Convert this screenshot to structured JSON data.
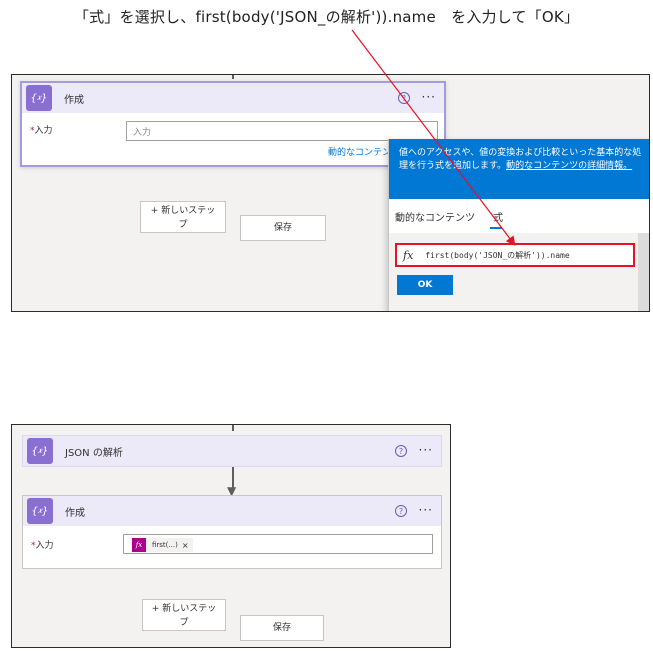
{
  "instruction": "「式」を選択し、first(body('JSON_の解析')).name　を入力して「OK」",
  "screen1": {
    "card_title": "作成",
    "input_label": "入力",
    "input_placeholder": "入力",
    "dynamic_content_link": "動的なコンテンツ",
    "new_step_line1": "+ 新しいステッ",
    "new_step_line2": "プ",
    "save_label": "保存",
    "panel": {
      "header_text": "値へのアクセスや、値の変換および比較といった基本的な処理を行う式を追加します。",
      "header_link": "動的なコンテンツの詳細情報。",
      "header_right": "非表",
      "tab_dynamic": "動的なコンテンツ",
      "tab_expression": "式",
      "expression_value": "first(body('JSON_の解析')).name",
      "ok_label": "OK"
    }
  },
  "screen2": {
    "parse_card_title": "JSON の解析",
    "compose_card_title": "作成",
    "input_label": "入力",
    "token_label": "first(...)",
    "token_close": "×",
    "new_step_line1": "+ 新しいステッ",
    "new_step_line2": "プ",
    "save_label": "保存"
  },
  "icons": {
    "op_icon": "data-operation-icon",
    "help": "help-icon",
    "more": "more-icon",
    "fx": "fx-icon"
  },
  "colors": {
    "accent": "#0078d4",
    "op_purple": "#8a6fd3",
    "header_lavender": "#ece9f8",
    "highlight_red": "#e81123",
    "token_magenta": "#ad008c"
  }
}
